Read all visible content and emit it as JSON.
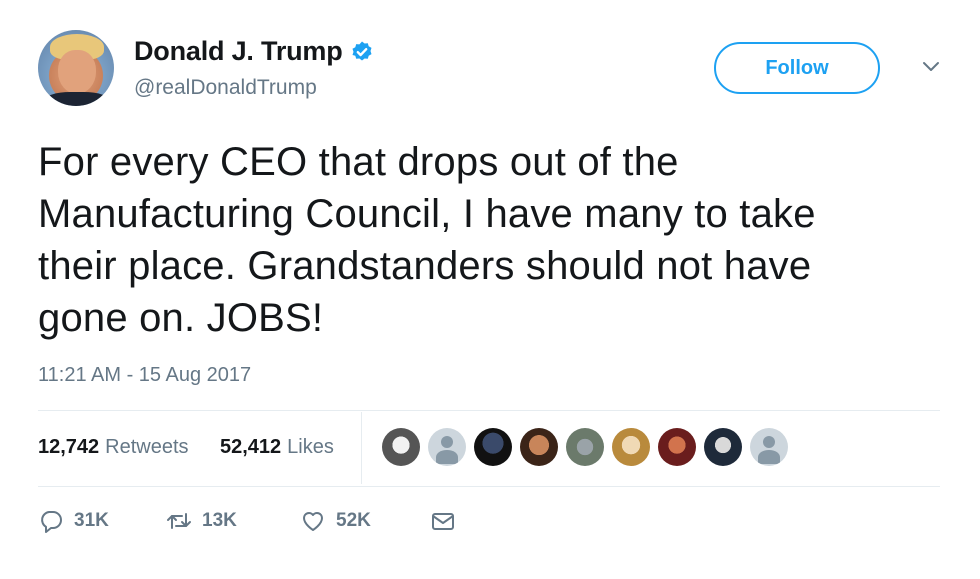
{
  "user": {
    "display_name": "Donald J. Trump",
    "handle": "@realDonaldTrump",
    "verified": true
  },
  "header": {
    "follow_label": "Follow"
  },
  "tweet": {
    "lines": [
      "For every CEO that drops out of the",
      "Manufacturing Council, I have many to take",
      "their place. Grandstanders should not have",
      "gone on. JOBS!"
    ],
    "timestamp": "11:21 AM - 15 Aug 2017"
  },
  "stats": {
    "retweets_count": "12,742",
    "retweets_label": "Retweets",
    "likes_count": "52,412",
    "likes_label": "Likes"
  },
  "actions": {
    "reply_count": "31K",
    "retweet_count": "13K",
    "like_count": "52K"
  },
  "colors": {
    "accent": "#1da1f2",
    "secondary_text": "#657786",
    "primary_text": "#14171a",
    "divider": "#e6ecf0"
  }
}
